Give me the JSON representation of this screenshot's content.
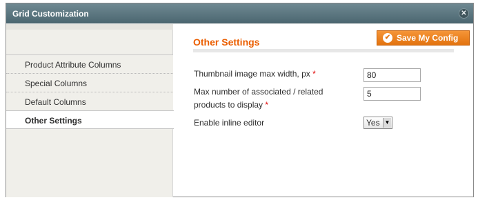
{
  "dialog": {
    "title": "Grid Customization",
    "close_icon": "close-icon"
  },
  "sidebar": {
    "items": [
      {
        "label": "Product Attribute Columns",
        "active": false
      },
      {
        "label": "Special Columns",
        "active": false
      },
      {
        "label": "Default Columns",
        "active": false
      },
      {
        "label": "Other Settings",
        "active": true
      }
    ]
  },
  "content": {
    "section_title": "Other Settings",
    "save_button": {
      "label": "Save My Config",
      "icon": "check-icon"
    },
    "fields": {
      "thumb_width": {
        "label": "Thumbnail image max width, px",
        "required_mark": "*",
        "value": "80"
      },
      "max_associated": {
        "label_line1": "Max number of associated / related",
        "label_line2": "products to display",
        "required_mark": "*",
        "value": "5"
      },
      "inline_editor": {
        "label": "Enable inline editor",
        "value": "Yes"
      }
    }
  },
  "colors": {
    "accent": "#eb5e00",
    "button": "#f08a25",
    "titlebar": "#5d7780"
  }
}
